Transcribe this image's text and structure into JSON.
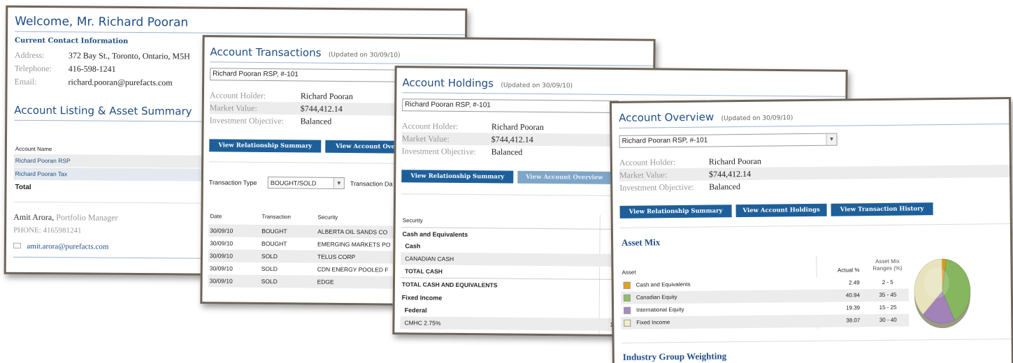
{
  "w1": {
    "title": "Welcome, Mr. Richard Pooran",
    "contact_heading": "Current Contact Information",
    "address_label": "Address:",
    "address_value": "372 Bay St., Toronto, Ontario, M5H",
    "telephone_label": "Telephone:",
    "telephone_value": "416-598-1241",
    "email_label": "Email:",
    "email_value": "richard.pooran@purefacts.com",
    "listing_title": "Account Listing & Asset Summary",
    "col_account_name": "Account Name",
    "accounts": [
      "Richard Pooran RSP",
      "Richard Pooran Tax"
    ],
    "total_label": "Total",
    "manager_name": "Amit Arora,",
    "manager_role": "Portfolio Manager",
    "manager_phone": "PHONE: 4165981241",
    "manager_email": "amit.arora@purefacts.com"
  },
  "w2": {
    "title": "Account Transactions",
    "updated": "(Updated on 30/09/10)",
    "account_select": "Richard Pooran RSP, #-101",
    "holder_label": "Account Holder:",
    "holder_value": "Richard Pooran",
    "market_label": "Market Value:",
    "market_value": "$744,412.14",
    "objective_label": "Investment Objective:",
    "objective_value": "Balanced",
    "btn_relationship": "View Relationship Summary",
    "btn_overview": "View Account Overview",
    "type_label": "Transaction Type",
    "type_value": "BOUGHT/SOLD",
    "date_label": "Transaction Da",
    "headers": [
      "Date",
      "Transaction",
      "Security"
    ],
    "rows": [
      [
        "30/09/10",
        "BOUGHT",
        "ALBERTA OIL SANDS CO"
      ],
      [
        "30/09/10",
        "BOUGHT",
        "EMERGING MARKETS PO"
      ],
      [
        "30/09/10",
        "SOLD",
        "TELUS CORP"
      ],
      [
        "30/09/10",
        "SOLD",
        "CDN ENERGY POOLED F"
      ],
      [
        "30/09/10",
        "SOLD",
        "EDGE"
      ]
    ]
  },
  "w3": {
    "title": "Account Holdings",
    "updated": "(Updated on 30/09/10)",
    "account_select": "Richard Pooran RSP, #-101",
    "holder_label": "Account Holder:",
    "holder_value": "Richard Pooran",
    "market_label": "Market Value:",
    "market_value": "$744,412.14",
    "objective_label": "Investment Objective:",
    "objective_value": "Balanced",
    "btn_relationship": "View Relationship Summary",
    "btn_overview": "View Account Overview",
    "col_security": "Security",
    "cash_equiv": "Cash and Equivalents",
    "cash": "Cash",
    "canadian_cash": "CANADIAN CASH",
    "total_cash": "TOTAL CASH",
    "total_cash_equiv": "TOTAL CASH AND EQUIVALENTS",
    "fixed_income": "Fixed Income",
    "federal": "Federal",
    "cmhc": "CMHC 2.75%",
    "partial_value": "1"
  },
  "w4": {
    "title": "Account Overview",
    "updated": "(Updated on 30/09/10)",
    "account_select": "Richard Pooran RSP, #-101",
    "holder_label": "Account Holder:",
    "holder_value": "Richard Pooran",
    "market_label": "Market Value:",
    "market_value": "$744,412.14",
    "objective_label": "Investment Objective:",
    "objective_value": "Balanced",
    "btn_relationship": "View Relationship Summary",
    "btn_holdings": "View Account Holdings",
    "btn_history": "View Transaction History",
    "asset_mix_title": "Asset Mix",
    "col_asset": "Asset",
    "col_actual": "Actual %",
    "col_range_1": "Asset Mix",
    "col_range_2": "Ranges (%)",
    "assets": [
      {
        "name": "Cash and Equivalents",
        "actual": "2.49",
        "range": "2 - 5",
        "color": "#e8a11a",
        "value": 2.49
      },
      {
        "name": "Canadian Equity",
        "actual": "40.94",
        "range": "35 - 45",
        "color": "#8dc063",
        "value": 40.94
      },
      {
        "name": "International Equity",
        "actual": "19.39",
        "range": "15 - 25",
        "color": "#a98ac3",
        "value": 19.39
      },
      {
        "name": "Fixed Income",
        "actual": "38.07",
        "range": "30 - 40",
        "color": "#f3efc7",
        "value": 38.07
      }
    ],
    "industry_title": "Industry Group Weighting"
  }
}
